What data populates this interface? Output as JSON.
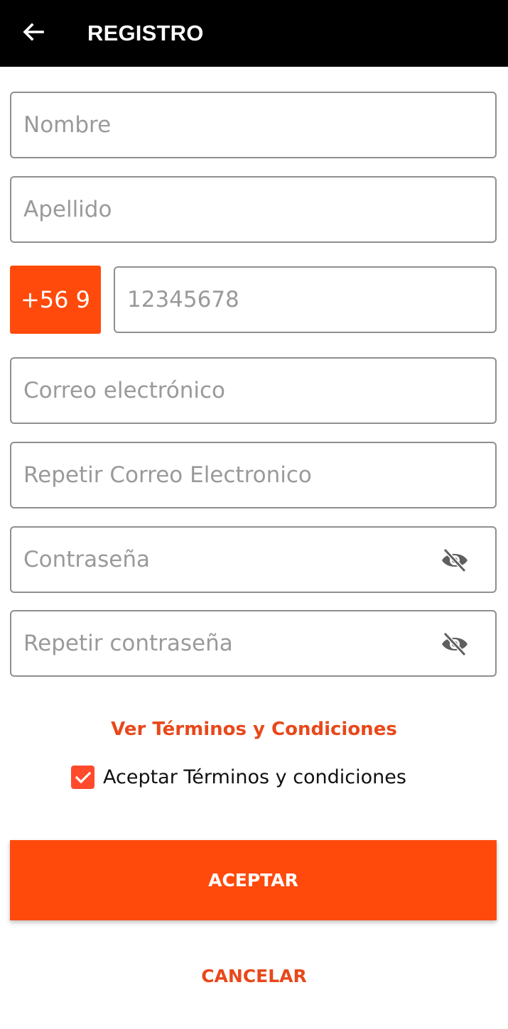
{
  "app_bar": {
    "title": "REGISTRO",
    "back_icon": "arrow-left-icon"
  },
  "form": {
    "nombre_placeholder": "Nombre",
    "apellido_placeholder": "Apellido",
    "phone_prefix": "+56 9",
    "phone_placeholder": "12345678",
    "email_placeholder": "Correo electrónico",
    "repeat_email_placeholder": "Repetir Correo Electronico",
    "password_placeholder": "Contraseña",
    "repeat_password_placeholder": "Repetir contraseña",
    "visibility_icon": "eye-off-icon"
  },
  "terms": {
    "link_label": "Ver Términos y Condiciones",
    "checkbox_label": "Aceptar Términos y condiciones",
    "checked": true
  },
  "actions": {
    "accept_label": "ACEPTAR",
    "cancel_label": "CANCELAR"
  },
  "colors": {
    "accent": "#ff4a0c",
    "link": "#e8481b",
    "app_bar": "#000000",
    "border": "#8f8f8f",
    "placeholder": "#9a9a9a"
  }
}
